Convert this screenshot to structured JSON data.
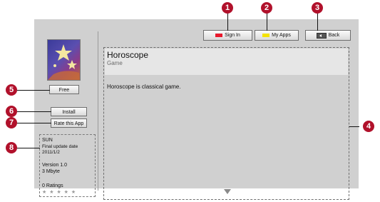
{
  "buttons": {
    "sign_in": "Sign In",
    "my_apps": "My Apps",
    "back": "Back",
    "free": "Free",
    "install": "Install",
    "rate": "Rate this App"
  },
  "colors": {
    "sign_in_swatch": "#e8192c",
    "my_apps_swatch": "#f4e300",
    "badge": "#b1112b"
  },
  "app": {
    "title": "Horoscope",
    "category": "Game",
    "description": "Horoscope is classical game."
  },
  "info": {
    "publisher": "SUN",
    "update_label": "Final update date",
    "update_date": "2011/1/2",
    "version": "Version 1.0",
    "size": "3 Mbyte",
    "ratings": "0 Ratings",
    "stars": "★ ★ ★ ★ ★"
  },
  "callouts": [
    "1",
    "2",
    "3",
    "4",
    "5",
    "6",
    "7",
    "8"
  ]
}
